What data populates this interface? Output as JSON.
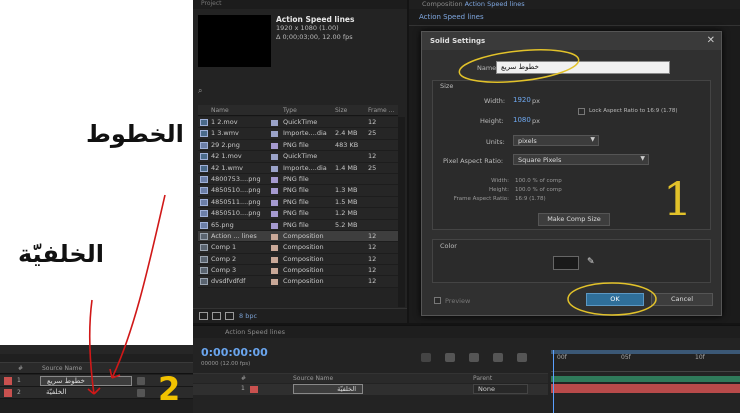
{
  "annotations": {
    "label_lines": "الخطوط",
    "label_background": "الخلفيّة",
    "number_dialog": "1",
    "number_layers": "2"
  },
  "left_layers": {
    "header_num": "#",
    "header_name": "Source Name",
    "rows": [
      {
        "num": "1",
        "name": "خطوط سريع",
        "color": "#c9514f"
      },
      {
        "num": "2",
        "name": "الخلفيّة",
        "color": "#c9514f"
      }
    ]
  },
  "project": {
    "panel_title": "Project",
    "comp_name": "Action Speed lines",
    "comp_size": "1920 x 1080 (1.00)",
    "comp_duration": "Δ 0;00;03;00, 12.00 fps",
    "columns": {
      "name": "Name",
      "type": "Type",
      "size": "Size",
      "frame": "Frame ..."
    },
    "files": [
      {
        "name": "1 2.mov",
        "type": "QuickTime",
        "size": "",
        "frame": "12",
        "kind": "mov",
        "label": "#9aa2c8"
      },
      {
        "name": "1 3.wmv",
        "type": "Importe....dia",
        "size": "2.4 MB",
        "frame": "25",
        "kind": "mov",
        "label": "#9aa2c8"
      },
      {
        "name": "29 2.png",
        "type": "PNG file",
        "size": "483 KB",
        "frame": "",
        "kind": "img",
        "label": "#a59ad0"
      },
      {
        "name": "42 1.mov",
        "type": "QuickTime",
        "size": "",
        "frame": "12",
        "kind": "mov",
        "label": "#9aa2c8"
      },
      {
        "name": "42 1.wmv",
        "type": "Importe....dia",
        "size": "1.4 MB",
        "frame": "25",
        "kind": "mov",
        "label": "#9aa2c8"
      },
      {
        "name": "4800753....png",
        "type": "PNG file",
        "size": "",
        "frame": "",
        "kind": "img",
        "label": "#a59ad0"
      },
      {
        "name": "4850510....png",
        "type": "PNG file",
        "size": "1.3 MB",
        "frame": "",
        "kind": "img",
        "label": "#a59ad0"
      },
      {
        "name": "4850511....png",
        "type": "PNG file",
        "size": "1.5 MB",
        "frame": "",
        "kind": "img",
        "label": "#a59ad0"
      },
      {
        "name": "4850510....png",
        "type": "PNG file",
        "size": "1.2 MB",
        "frame": "",
        "kind": "img",
        "label": "#a59ad0"
      },
      {
        "name": "65.png",
        "type": "PNG file",
        "size": "5.2 MB",
        "frame": "",
        "kind": "img",
        "label": "#a59ad0"
      },
      {
        "name": "Action ... lines",
        "type": "Composition",
        "size": "",
        "frame": "12",
        "kind": "comp",
        "label": "#c9a898",
        "selected": true
      },
      {
        "name": "Comp 1",
        "type": "Composition",
        "size": "",
        "frame": "12",
        "kind": "comp",
        "label": "#c9a898"
      },
      {
        "name": "Comp 2",
        "type": "Composition",
        "size": "",
        "frame": "12",
        "kind": "comp",
        "label": "#c9a898"
      },
      {
        "name": "Comp 3",
        "type": "Composition",
        "size": "",
        "frame": "12",
        "kind": "comp",
        "label": "#c9a898"
      },
      {
        "name": "dvsdfvdfdf",
        "type": "Composition",
        "size": "",
        "frame": "12",
        "kind": "comp",
        "label": "#c9a898"
      }
    ],
    "bpc": "8 bpc"
  },
  "composition": {
    "tab_label": "Composition",
    "tab_name": "Action Speed lines",
    "sub_tab": "Action Speed lines"
  },
  "dialog": {
    "title": "Solid Settings",
    "name_label": "Name:",
    "name_value": "خطوط سريع",
    "size_group": "Size",
    "width_label": "Width:",
    "width_value": "1920",
    "width_unit": "px",
    "height_label": "Height:",
    "height_value": "1080",
    "height_unit": "px",
    "lock_label": "Lock Aspect Ratio to 16:9 (1.78)",
    "units_label": "Units:",
    "units_value": "pixels",
    "par_label": "Pixel Aspect Ratio:",
    "par_value": "Square Pixels",
    "width_pct": "Width:",
    "width_pct_value": "100.0 % of comp",
    "height_pct": "Height:",
    "height_pct_value": "100.0 % of comp",
    "frame_ar": "Frame Aspect Ratio:",
    "frame_ar_value": "16:9 (1.78)",
    "make_comp_size": "Make Comp Size",
    "color_group": "Color",
    "preview_label": "Preview",
    "ok": "OK",
    "cancel": "Cancel"
  },
  "timeline": {
    "tab_name": "Action Speed lines",
    "time": "0:00:00:00",
    "fps": "00000 (12.00 fps)",
    "header_num": "#",
    "header_name": "Source Name",
    "header_parent": "Parent",
    "layer_num": "1",
    "layer_name": "الخلفيّة",
    "parent_value": "None",
    "ruler": [
      "00f",
      "05f",
      "10f"
    ]
  },
  "colors": {
    "accent_blue": "#6ea8f0",
    "annotation_yellow": "#e2c22a",
    "annotation_red": "#d01818",
    "ok_button": "#2f6f9a"
  }
}
